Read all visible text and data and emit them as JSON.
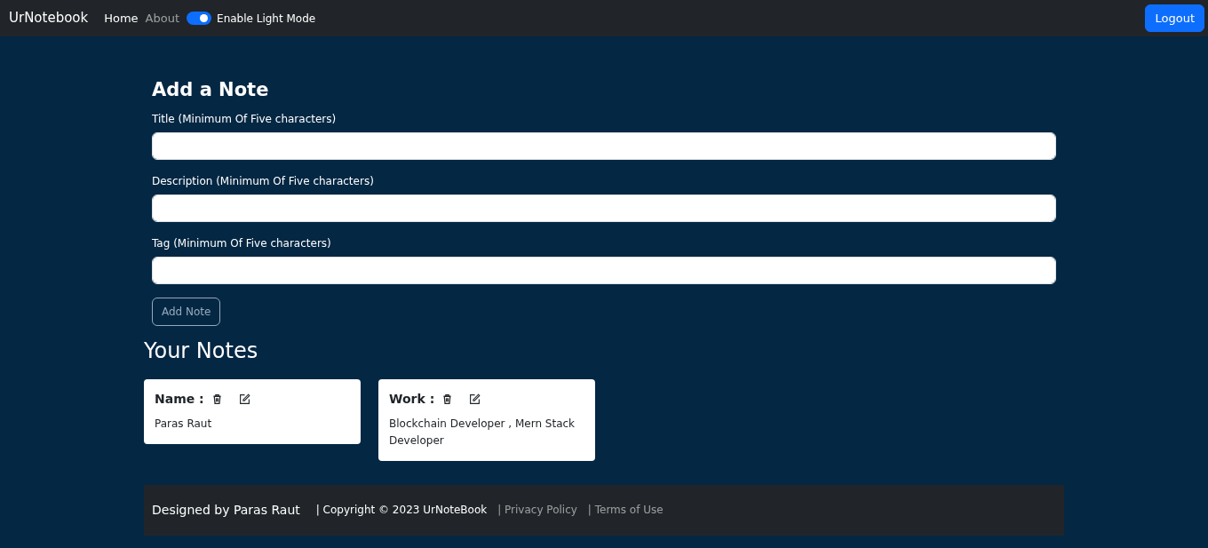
{
  "navbar": {
    "brand": "UrNotebook",
    "links": [
      {
        "label": "Home",
        "selected": true
      },
      {
        "label": "About",
        "selected": false
      }
    ],
    "mode_switch": {
      "label": "Enable Light Mode",
      "on": true
    },
    "logout_button": "Logout"
  },
  "add_note": {
    "heading": "Add a Note",
    "fields": [
      {
        "label": "Title (Minimum Of Five characters)"
      },
      {
        "label": "Description (Minimum Of Five characters)"
      },
      {
        "label": "Tag (Minimum Of Five characters)"
      }
    ],
    "submit": {
      "label": "Add Note",
      "disabled": true
    }
  },
  "notes": {
    "heading": "Your Notes",
    "items": [
      {
        "title": "Name :",
        "description": "Paras Raut"
      },
      {
        "title": "Work :",
        "description": "Blockchain Developer , Mern Stack Developer"
      }
    ]
  },
  "footer": {
    "designer": "Designed by Paras Raut",
    "copyright": "| Copyright © 2023 UrNoteBook",
    "links": [
      "| Privacy Policy",
      "| Terms of Use"
    ]
  }
}
